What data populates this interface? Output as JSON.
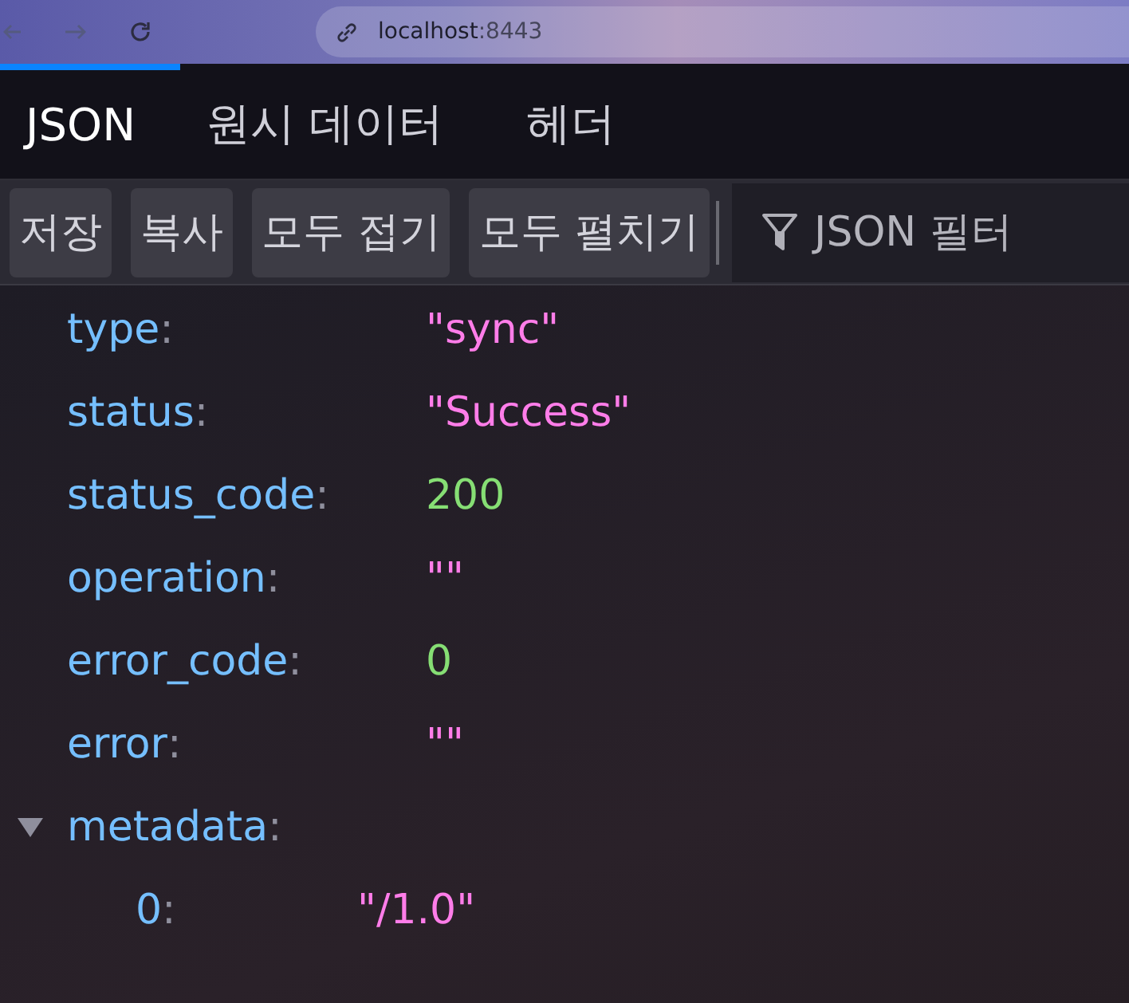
{
  "browser": {
    "url_host": "localhost",
    "url_port": ":8443"
  },
  "tabs": [
    {
      "label": "JSON",
      "selected": true
    },
    {
      "label": "원시 데이터",
      "selected": false
    },
    {
      "label": "헤더",
      "selected": false
    }
  ],
  "toolbar": {
    "buttons": [
      "저장",
      "복사",
      "모두 접기",
      "모두 펼치기"
    ],
    "filter": {
      "placeholder": "JSON 필터"
    }
  },
  "key_separator": ":",
  "rows": [
    {
      "key": "type",
      "value": "\"sync\"",
      "kind": "string"
    },
    {
      "key": "status",
      "value": "\"Success\"",
      "kind": "string"
    },
    {
      "key": "status_code",
      "value": "200",
      "kind": "number"
    },
    {
      "key": "operation",
      "value": "\"\"",
      "kind": "string"
    },
    {
      "key": "error_code",
      "value": "0",
      "kind": "number"
    },
    {
      "key": "error",
      "value": "\"\"",
      "kind": "string"
    },
    {
      "key": "metadata",
      "expanded": true,
      "children": [
        {
          "key": "0",
          "value": "\"/1.0\"",
          "kind": "string"
        }
      ]
    }
  ]
}
